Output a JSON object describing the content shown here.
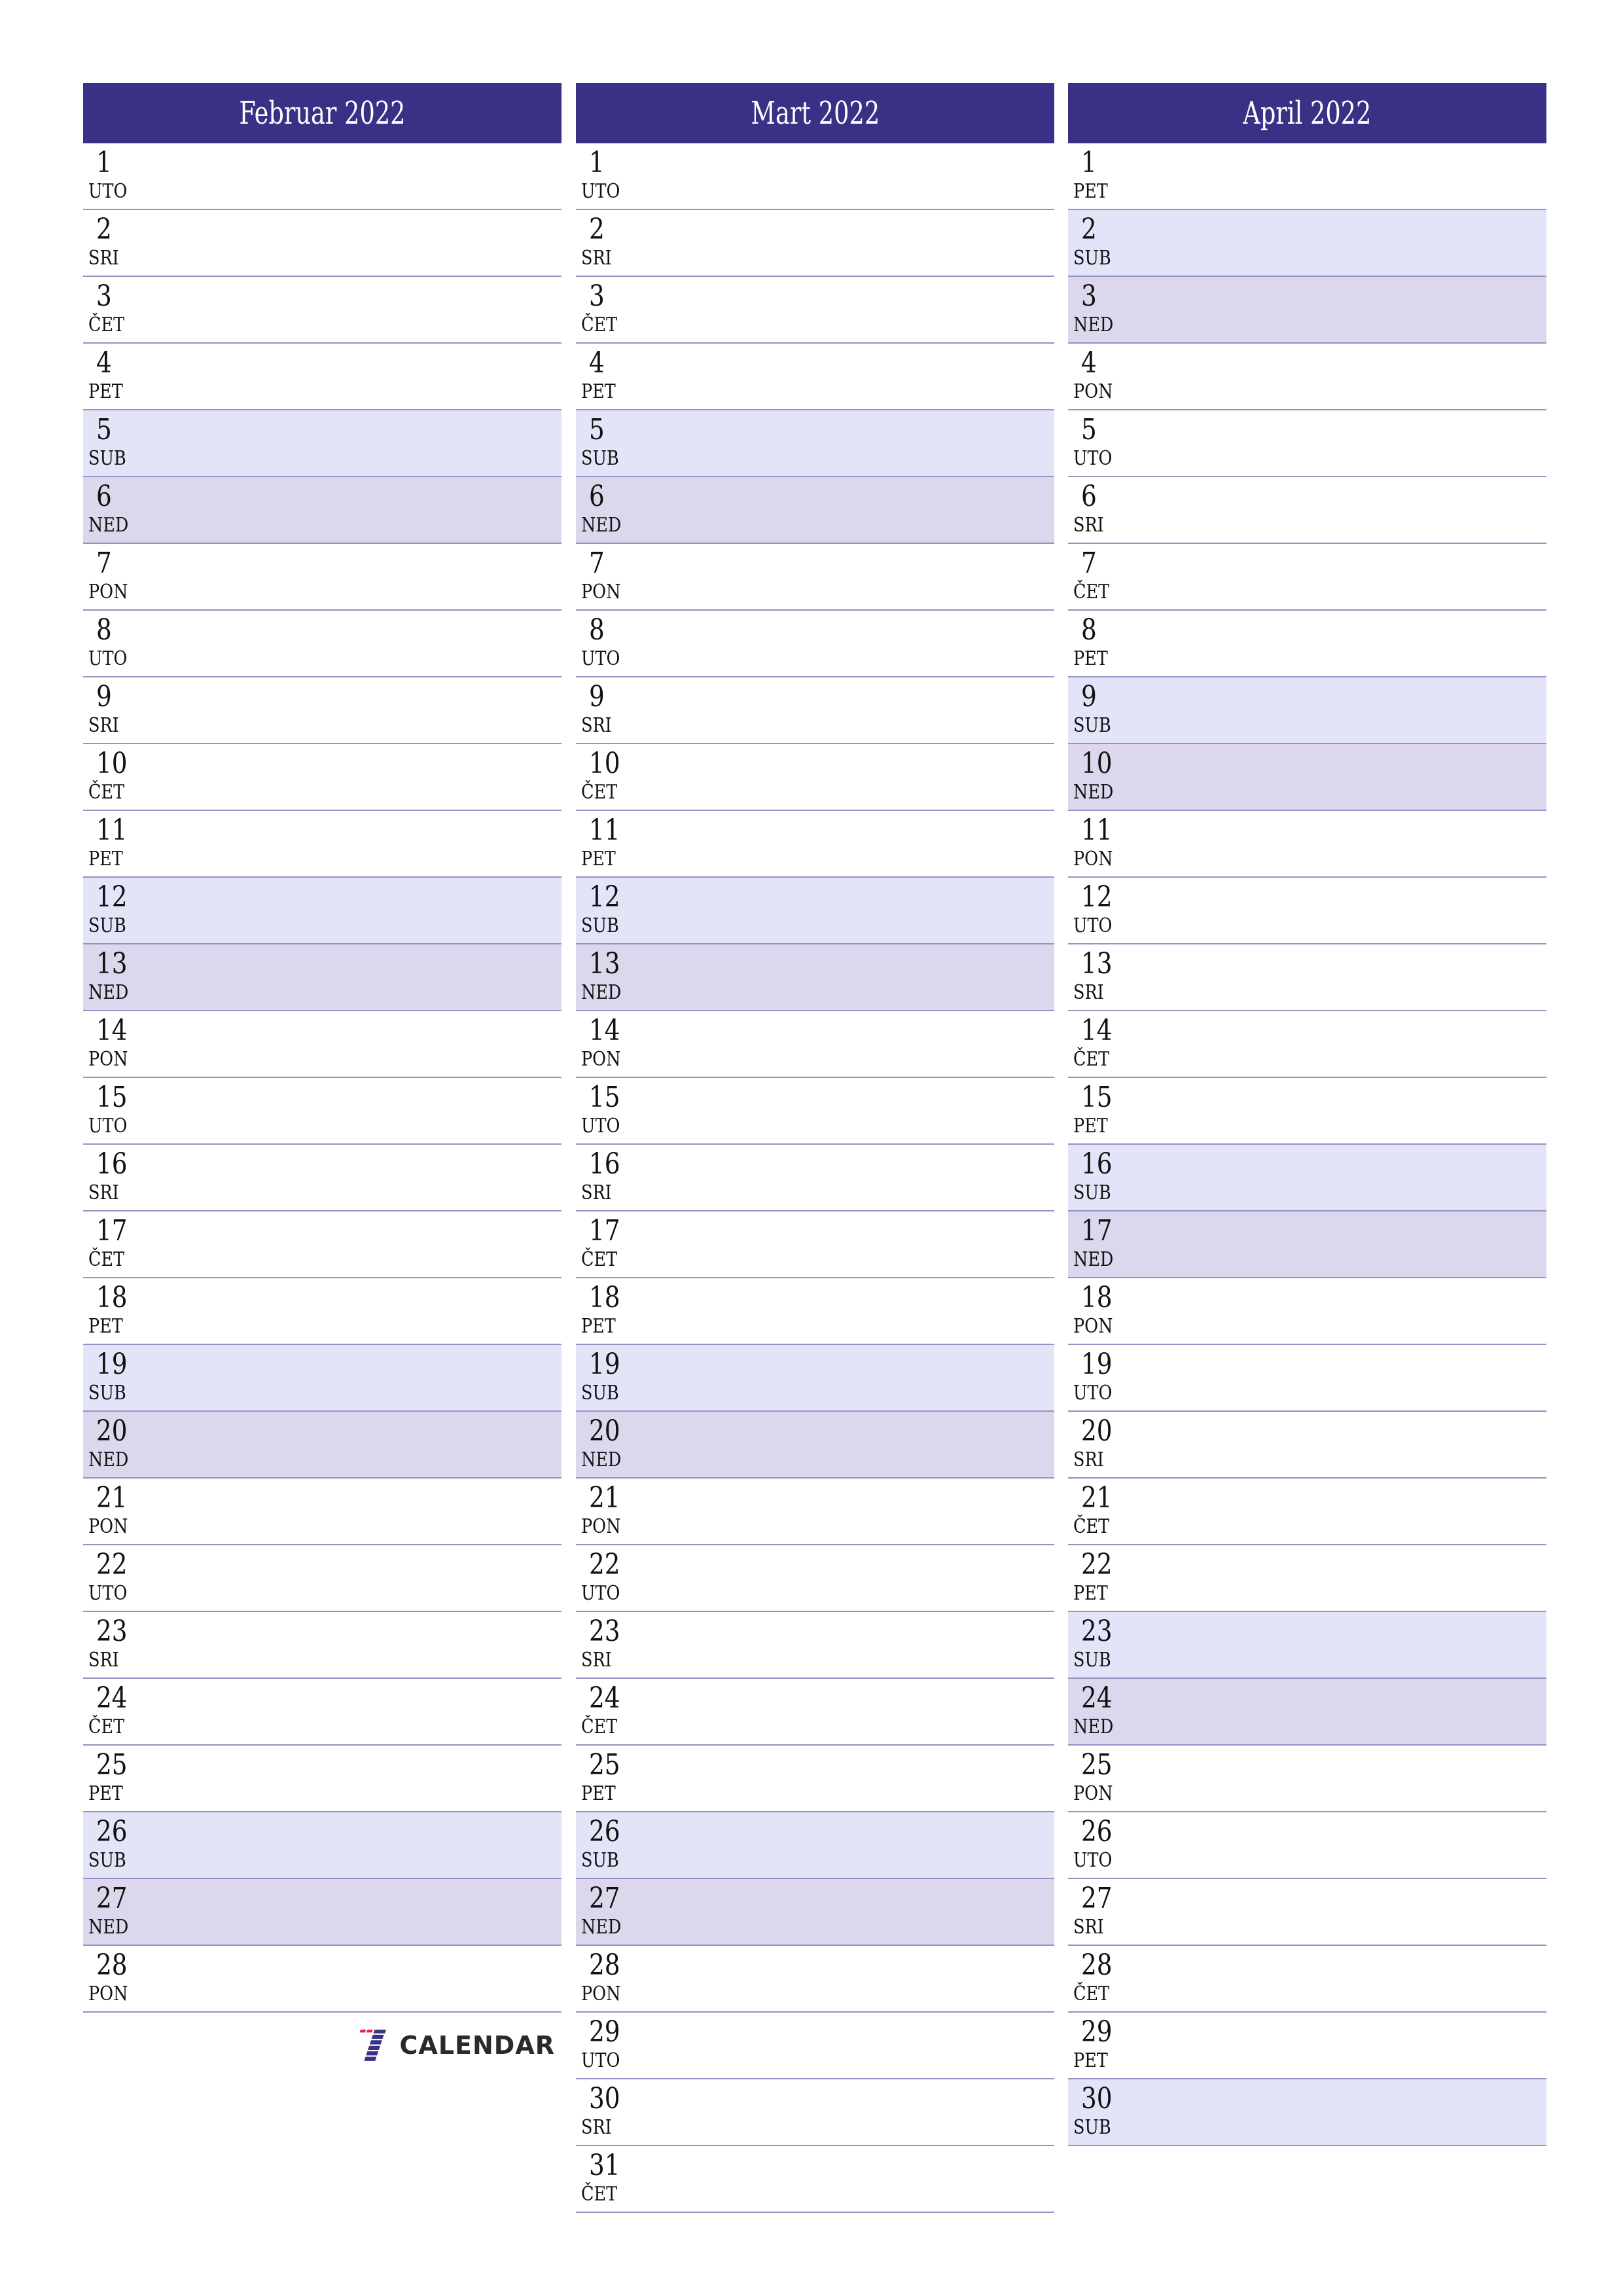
{
  "colors": {
    "header_bg": "#393185",
    "saturday_bg": "#e4e4f8",
    "sunday_bg": "#dcd7ec",
    "row_border": "#9592c4",
    "logo_red": "#ef1d4a",
    "logo_blue": "#393185"
  },
  "months": [
    {
      "title": "Februar 2022",
      "days": [
        {
          "n": "1",
          "d": "UTO"
        },
        {
          "n": "2",
          "d": "SRI"
        },
        {
          "n": "3",
          "d": "ČET"
        },
        {
          "n": "4",
          "d": "PET"
        },
        {
          "n": "5",
          "d": "SUB"
        },
        {
          "n": "6",
          "d": "NED"
        },
        {
          "n": "7",
          "d": "PON"
        },
        {
          "n": "8",
          "d": "UTO"
        },
        {
          "n": "9",
          "d": "SRI"
        },
        {
          "n": "10",
          "d": "ČET"
        },
        {
          "n": "11",
          "d": "PET"
        },
        {
          "n": "12",
          "d": "SUB"
        },
        {
          "n": "13",
          "d": "NED"
        },
        {
          "n": "14",
          "d": "PON"
        },
        {
          "n": "15",
          "d": "UTO"
        },
        {
          "n": "16",
          "d": "SRI"
        },
        {
          "n": "17",
          "d": "ČET"
        },
        {
          "n": "18",
          "d": "PET"
        },
        {
          "n": "19",
          "d": "SUB"
        },
        {
          "n": "20",
          "d": "NED"
        },
        {
          "n": "21",
          "d": "PON"
        },
        {
          "n": "22",
          "d": "UTO"
        },
        {
          "n": "23",
          "d": "SRI"
        },
        {
          "n": "24",
          "d": "ČET"
        },
        {
          "n": "25",
          "d": "PET"
        },
        {
          "n": "26",
          "d": "SUB"
        },
        {
          "n": "27",
          "d": "NED"
        },
        {
          "n": "28",
          "d": "PON"
        }
      ]
    },
    {
      "title": "Mart 2022",
      "days": [
        {
          "n": "1",
          "d": "UTO"
        },
        {
          "n": "2",
          "d": "SRI"
        },
        {
          "n": "3",
          "d": "ČET"
        },
        {
          "n": "4",
          "d": "PET"
        },
        {
          "n": "5",
          "d": "SUB"
        },
        {
          "n": "6",
          "d": "NED"
        },
        {
          "n": "7",
          "d": "PON"
        },
        {
          "n": "8",
          "d": "UTO"
        },
        {
          "n": "9",
          "d": "SRI"
        },
        {
          "n": "10",
          "d": "ČET"
        },
        {
          "n": "11",
          "d": "PET"
        },
        {
          "n": "12",
          "d": "SUB"
        },
        {
          "n": "13",
          "d": "NED"
        },
        {
          "n": "14",
          "d": "PON"
        },
        {
          "n": "15",
          "d": "UTO"
        },
        {
          "n": "16",
          "d": "SRI"
        },
        {
          "n": "17",
          "d": "ČET"
        },
        {
          "n": "18",
          "d": "PET"
        },
        {
          "n": "19",
          "d": "SUB"
        },
        {
          "n": "20",
          "d": "NED"
        },
        {
          "n": "21",
          "d": "PON"
        },
        {
          "n": "22",
          "d": "UTO"
        },
        {
          "n": "23",
          "d": "SRI"
        },
        {
          "n": "24",
          "d": "ČET"
        },
        {
          "n": "25",
          "d": "PET"
        },
        {
          "n": "26",
          "d": "SUB"
        },
        {
          "n": "27",
          "d": "NED"
        },
        {
          "n": "28",
          "d": "PON"
        },
        {
          "n": "29",
          "d": "UTO"
        },
        {
          "n": "30",
          "d": "SRI"
        },
        {
          "n": "31",
          "d": "ČET"
        }
      ]
    },
    {
      "title": "April 2022",
      "days": [
        {
          "n": "1",
          "d": "PET"
        },
        {
          "n": "2",
          "d": "SUB"
        },
        {
          "n": "3",
          "d": "NED"
        },
        {
          "n": "4",
          "d": "PON"
        },
        {
          "n": "5",
          "d": "UTO"
        },
        {
          "n": "6",
          "d": "SRI"
        },
        {
          "n": "7",
          "d": "ČET"
        },
        {
          "n": "8",
          "d": "PET"
        },
        {
          "n": "9",
          "d": "SUB"
        },
        {
          "n": "10",
          "d": "NED"
        },
        {
          "n": "11",
          "d": "PON"
        },
        {
          "n": "12",
          "d": "UTO"
        },
        {
          "n": "13",
          "d": "SRI"
        },
        {
          "n": "14",
          "d": "ČET"
        },
        {
          "n": "15",
          "d": "PET"
        },
        {
          "n": "16",
          "d": "SUB"
        },
        {
          "n": "17",
          "d": "NED"
        },
        {
          "n": "18",
          "d": "PON"
        },
        {
          "n": "19",
          "d": "UTO"
        },
        {
          "n": "20",
          "d": "SRI"
        },
        {
          "n": "21",
          "d": "ČET"
        },
        {
          "n": "22",
          "d": "PET"
        },
        {
          "n": "23",
          "d": "SUB"
        },
        {
          "n": "24",
          "d": "NED"
        },
        {
          "n": "25",
          "d": "PON"
        },
        {
          "n": "26",
          "d": "UTO"
        },
        {
          "n": "27",
          "d": "SRI"
        },
        {
          "n": "28",
          "d": "ČET"
        },
        {
          "n": "29",
          "d": "PET"
        },
        {
          "n": "30",
          "d": "SUB"
        }
      ]
    }
  ],
  "logo": {
    "icon": "seven-calendar-logo-icon",
    "text": "CALENDAR"
  }
}
